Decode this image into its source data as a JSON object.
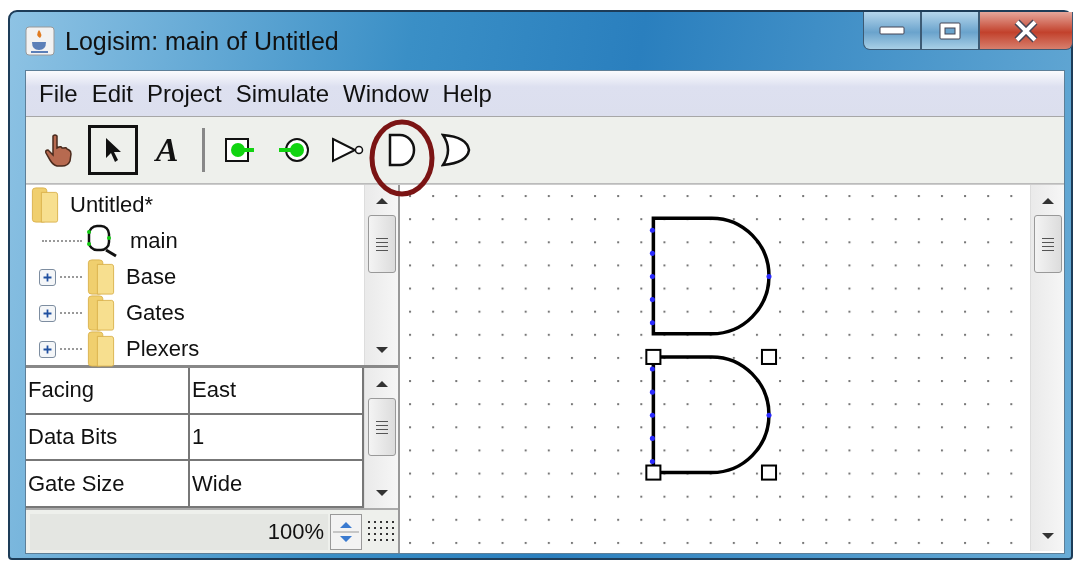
{
  "window": {
    "title": "Logisim: main of Untitled"
  },
  "menu": [
    "File",
    "Edit",
    "Project",
    "Simulate",
    "Window",
    "Help"
  ],
  "toolbar": [
    {
      "kind": "poke",
      "selected": false,
      "circled": false
    },
    {
      "kind": "select",
      "selected": true,
      "circled": false
    },
    {
      "kind": "text",
      "label": "A",
      "selected": false,
      "circled": false
    },
    {
      "kind": "separator"
    },
    {
      "kind": "input-pin",
      "selected": false,
      "circled": false
    },
    {
      "kind": "output-pin",
      "selected": false,
      "circled": false
    },
    {
      "kind": "not-gate",
      "selected": false,
      "circled": false
    },
    {
      "kind": "and-gate",
      "selected": false,
      "circled": true
    },
    {
      "kind": "or-gate",
      "selected": false,
      "circled": false
    }
  ],
  "explorer": {
    "root": {
      "label": "Untitled*",
      "children": [
        {
          "kind": "circuit",
          "label": "main"
        },
        {
          "kind": "library",
          "label": "Base",
          "expanded": false
        },
        {
          "kind": "library",
          "label": "Gates",
          "expanded": false
        },
        {
          "kind": "library",
          "label": "Plexers",
          "expanded": false
        }
      ]
    }
  },
  "attributes": [
    {
      "name": "Facing",
      "value": "East"
    },
    {
      "name": "Data Bits",
      "value": "1"
    },
    {
      "name": "Gate Size",
      "value": "Wide"
    }
  ],
  "zoom": {
    "value": "100%"
  },
  "canvas": {
    "components": [
      {
        "kind": "and-gate",
        "selected": false
      },
      {
        "kind": "and-gate",
        "selected": true
      }
    ]
  }
}
